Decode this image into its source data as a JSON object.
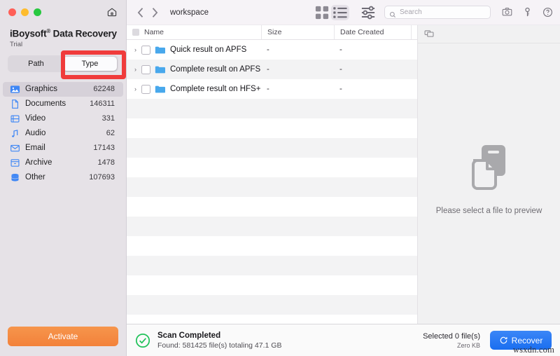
{
  "sidebar": {
    "window_controls": [
      "close",
      "minimize",
      "maximize"
    ],
    "home_icon": "home-icon",
    "brand_title": "iBoysoft",
    "brand_reg": "®",
    "brand_title_rest": " Data Recovery",
    "brand_subtitle": "Trial",
    "segmented": {
      "path_label": "Path",
      "type_label": "Type",
      "selected": "Type",
      "highlight_color": "#f03b3b"
    },
    "categories": [
      {
        "label": "Graphics",
        "count": "62248",
        "icon": "image-icon",
        "selected": true
      },
      {
        "label": "Documents",
        "count": "146311",
        "icon": "document-icon",
        "selected": false
      },
      {
        "label": "Video",
        "count": "331",
        "icon": "video-icon",
        "selected": false
      },
      {
        "label": "Audio",
        "count": "62",
        "icon": "audio-icon",
        "selected": false
      },
      {
        "label": "Email",
        "count": "17143",
        "icon": "email-icon",
        "selected": false
      },
      {
        "label": "Archive",
        "count": "1478",
        "icon": "archive-icon",
        "selected": false
      },
      {
        "label": "Other",
        "count": "107693",
        "icon": "database-icon",
        "selected": false
      }
    ],
    "activate_label": "Activate",
    "activate_color": "#f5893e"
  },
  "toolbar": {
    "back_icon": "chevron-left-icon",
    "forward_icon": "chevron-right-icon",
    "breadcrumb": "workspace",
    "grid_view_icon": "grid-view-icon",
    "list_view_icon": "list-view-icon",
    "active_view": "list",
    "filter_icon": "filter-sliders-icon",
    "search": {
      "placeholder": "Search",
      "value": "",
      "icon": "search-icon"
    },
    "camera_icon": "camera-icon",
    "key_icon": "key-icon",
    "help_icon": "help-icon"
  },
  "filelist": {
    "columns": [
      "Name",
      "Size",
      "Date Created"
    ],
    "header_checkbox": "unchecked",
    "rows": [
      {
        "name": "Quick result on APFS",
        "size": "-",
        "date": "-",
        "icon": "folder-icon",
        "checked": false,
        "expandable": true
      },
      {
        "name": "Complete result on APFS",
        "size": "-",
        "date": "-",
        "icon": "folder-icon",
        "checked": false,
        "expandable": true
      },
      {
        "name": "Complete result on HFS+",
        "size": "-",
        "date": "-",
        "icon": "folder-icon",
        "checked": false,
        "expandable": true
      }
    ]
  },
  "preview": {
    "panel_icon": "layers-icon",
    "art_icon": "documents-stack-icon",
    "empty_message": "Please select a file to preview"
  },
  "status": {
    "status_icon": "check-circle-icon",
    "title": "Scan Completed",
    "subtitle": "Found: 581425 file(s) totaling 47.1 GB",
    "selected_label": "Selected 0 file(s)",
    "selected_size": "Zero KB",
    "recover_label": "Recover",
    "recover_icon": "refresh-icon",
    "recover_color": "#1a6ef0",
    "watermark": "wsxdn.com"
  }
}
